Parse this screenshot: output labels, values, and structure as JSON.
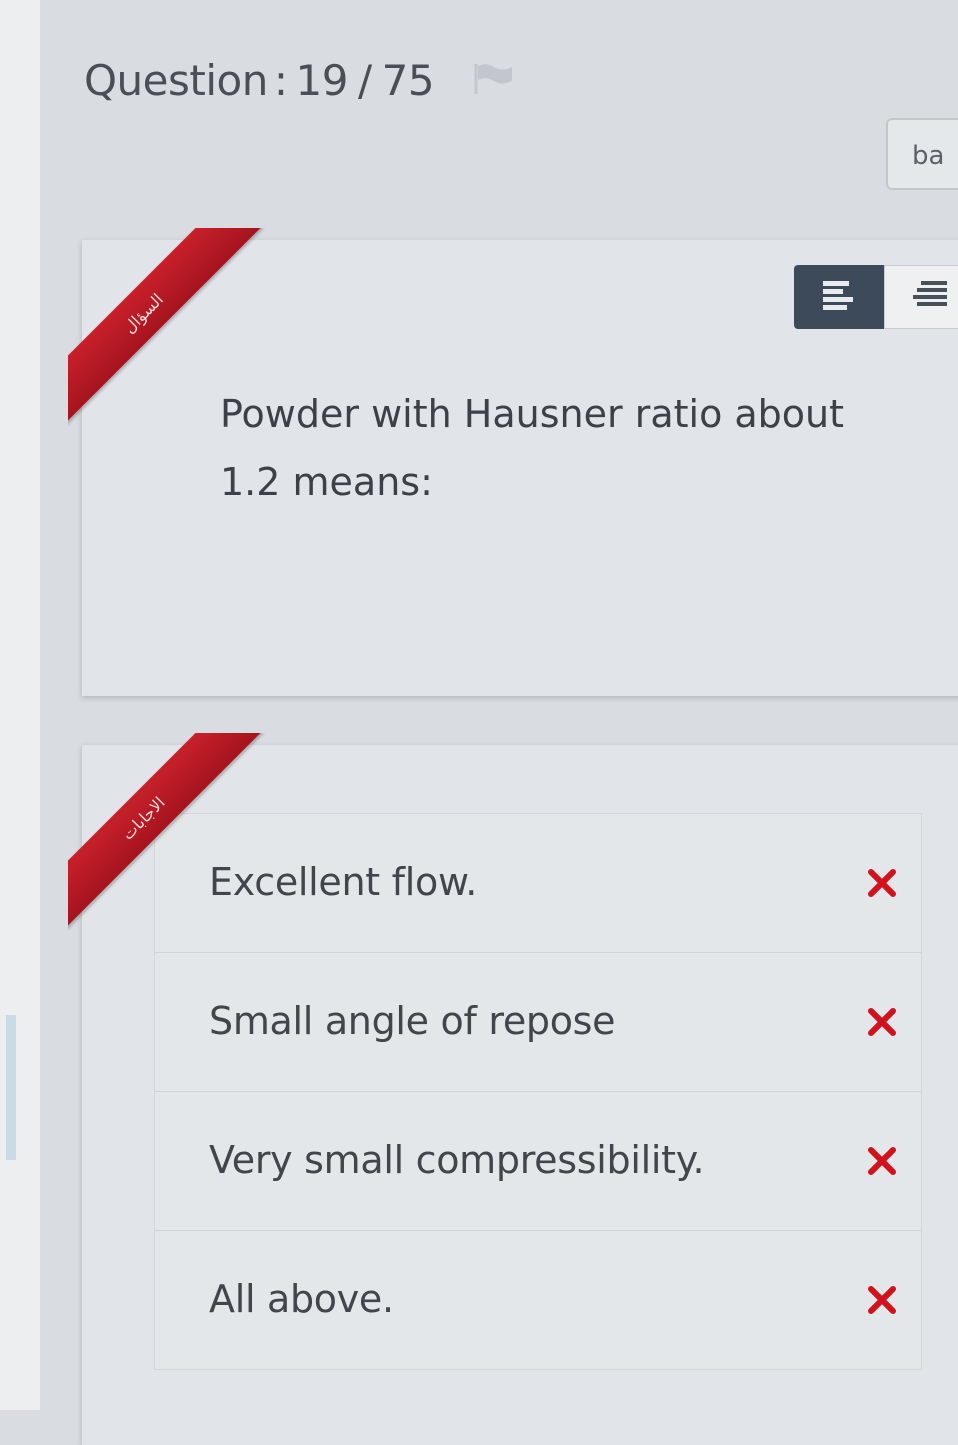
{
  "header": {
    "label": "Question",
    "separator": ":",
    "current": "19",
    "slash": "/",
    "total": "75"
  },
  "lang_button": {
    "label": "ba"
  },
  "question_card": {
    "ribbon_label": "السؤال",
    "text": "Powder with Hausner ratio about 1.2 means:"
  },
  "answers_card": {
    "ribbon_label": "الاجابات",
    "options": [
      {
        "text": "Excellent flow.",
        "status_icon": "x-mark-icon"
      },
      {
        "text": "Small angle of repose",
        "status_icon": "x-mark-icon"
      },
      {
        "text": "Very small compressibility.",
        "status_icon": "x-mark-icon"
      },
      {
        "text": "All above.",
        "status_icon": "x-mark-icon"
      }
    ]
  },
  "colors": {
    "ribbon": "#b8161f",
    "wrong_mark": "#d1121c",
    "toggle_active": "#3d4a5a"
  }
}
